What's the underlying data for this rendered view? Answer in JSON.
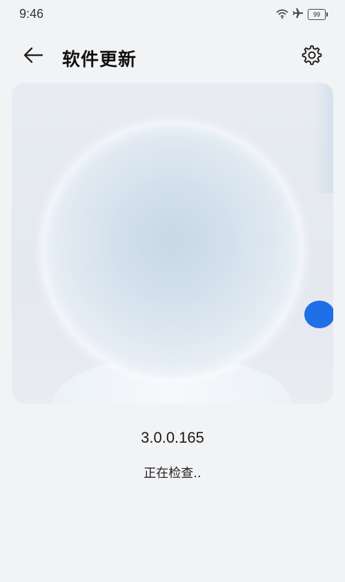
{
  "status_bar": {
    "time": "9:46",
    "battery_level": "99",
    "icons": [
      "wifi-icon",
      "airplane-icon",
      "battery-icon"
    ]
  },
  "app_bar": {
    "title": "软件更新",
    "back_icon": "arrow-left-icon",
    "settings_icon": "gear-icon"
  },
  "update": {
    "version": "3.0.0.165",
    "status": "正在检查.."
  },
  "colors": {
    "background": "#f2f3f5",
    "accent_dot": "#1f6fe6"
  }
}
